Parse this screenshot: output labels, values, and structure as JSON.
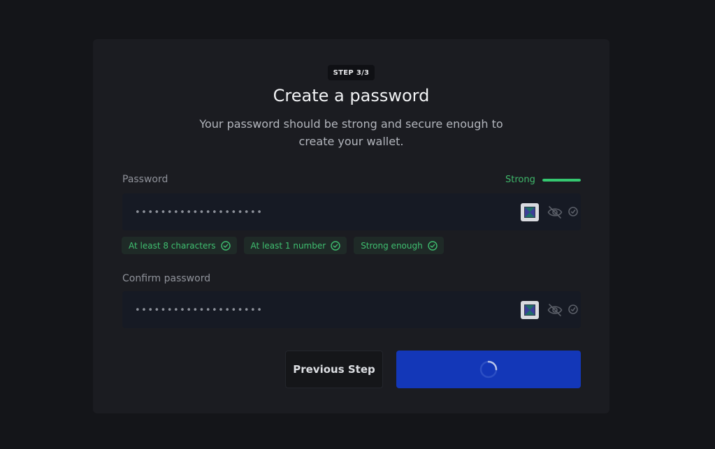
{
  "wizard": {
    "step_label": "STEP 3/3",
    "title": "Create a password",
    "subtitle_line1": "Your password should be strong and secure enough to",
    "subtitle_line2": "create your wallet."
  },
  "password_field": {
    "label": "Password",
    "value": "••••••••••••••••••••",
    "strength_label": "Strong",
    "strength_level": 1.0
  },
  "requirements": [
    {
      "label": "At least 8 characters",
      "met": true
    },
    {
      "label": "At least 1 number",
      "met": true
    },
    {
      "label": "Strong enough",
      "met": true
    }
  ],
  "confirm_field": {
    "label": "Confirm password",
    "value": "••••••••••••••••••••"
  },
  "buttons": {
    "previous_label": "Previous Step",
    "next_state": "loading"
  },
  "colors": {
    "background": "#141519",
    "card": "#1b1c21",
    "success": "#3fbf70",
    "primary": "#1337b8"
  },
  "icons": {
    "password_manager": "password-manager-icon",
    "visibility": "eye-off-icon",
    "extra": "autofill-icon",
    "requirement": "check-circle-icon",
    "loading": "spinner-icon"
  }
}
